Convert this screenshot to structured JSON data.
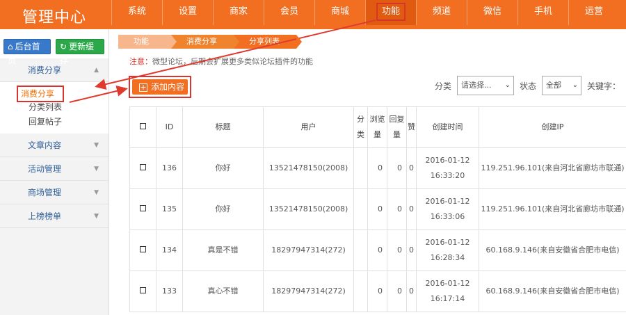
{
  "app": {
    "logo": "管理中心"
  },
  "nav": [
    {
      "label": "系统"
    },
    {
      "label": "设置"
    },
    {
      "label": "商家"
    },
    {
      "label": "会员"
    },
    {
      "label": "商城"
    },
    {
      "label": "功能"
    },
    {
      "label": "频道"
    },
    {
      "label": "微信"
    },
    {
      "label": "手机"
    },
    {
      "label": "运营"
    }
  ],
  "sidebar": {
    "home_btn": "后台首页",
    "refresh_btn": "更新缓存",
    "sections": [
      {
        "label": "消费分享",
        "items": [
          "消费分享",
          "分类列表",
          "回复帖子"
        ]
      },
      {
        "label": "文章内容"
      },
      {
        "label": "活动管理"
      },
      {
        "label": "商场管理"
      },
      {
        "label": "上榜榜单"
      }
    ]
  },
  "breadcrumb": [
    "功能",
    "消费分享",
    "分享列表"
  ],
  "note": {
    "prefix": "注意：",
    "text": "微型论坛，后期会扩展更多类似论坛插件的功能"
  },
  "toolbar": {
    "add_label": "添加内容",
    "category_label": "分类",
    "category_value": "请选择...",
    "status_label": "状态",
    "status_value": "全部",
    "keyword_label": "关键字："
  },
  "table": {
    "headers": [
      "ID",
      "标题",
      "用户",
      "分类",
      "浏览量",
      "回复量",
      "赞",
      "创建时间",
      "创建IP"
    ],
    "rows": [
      {
        "id": "136",
        "title": "你好",
        "user": "13521478150(2008)",
        "views": "0",
        "replies": "0",
        "likes": "0",
        "date": "2016-01-12",
        "time": "16:33:20",
        "ip": "119.251.96.101(来自河北省廊坊市联通)"
      },
      {
        "id": "135",
        "title": "你好",
        "user": "13521478150(2008)",
        "views": "0",
        "replies": "0",
        "likes": "0",
        "date": "2016-01-12",
        "time": "16:33:06",
        "ip": "119.251.96.101(来自河北省廊坊市联通)"
      },
      {
        "id": "134",
        "title": "真是不错",
        "user": "18297947314(272)",
        "views": "0",
        "replies": "0",
        "likes": "0",
        "date": "2016-01-12",
        "time": "16:28:34",
        "ip": "60.168.9.146(来自安徽省合肥市电信)"
      },
      {
        "id": "133",
        "title": "真心不错",
        "user": "18297947314(272)",
        "views": "0",
        "replies": "0",
        "likes": "0",
        "date": "2016-01-12",
        "time": "16:17:14",
        "ip": "60.168.9.146(来自安徽省合肥市电信)"
      }
    ]
  },
  "colors": {
    "brand": "#f26f22",
    "annotation": "#d9342b",
    "link": "#2d5e97"
  }
}
